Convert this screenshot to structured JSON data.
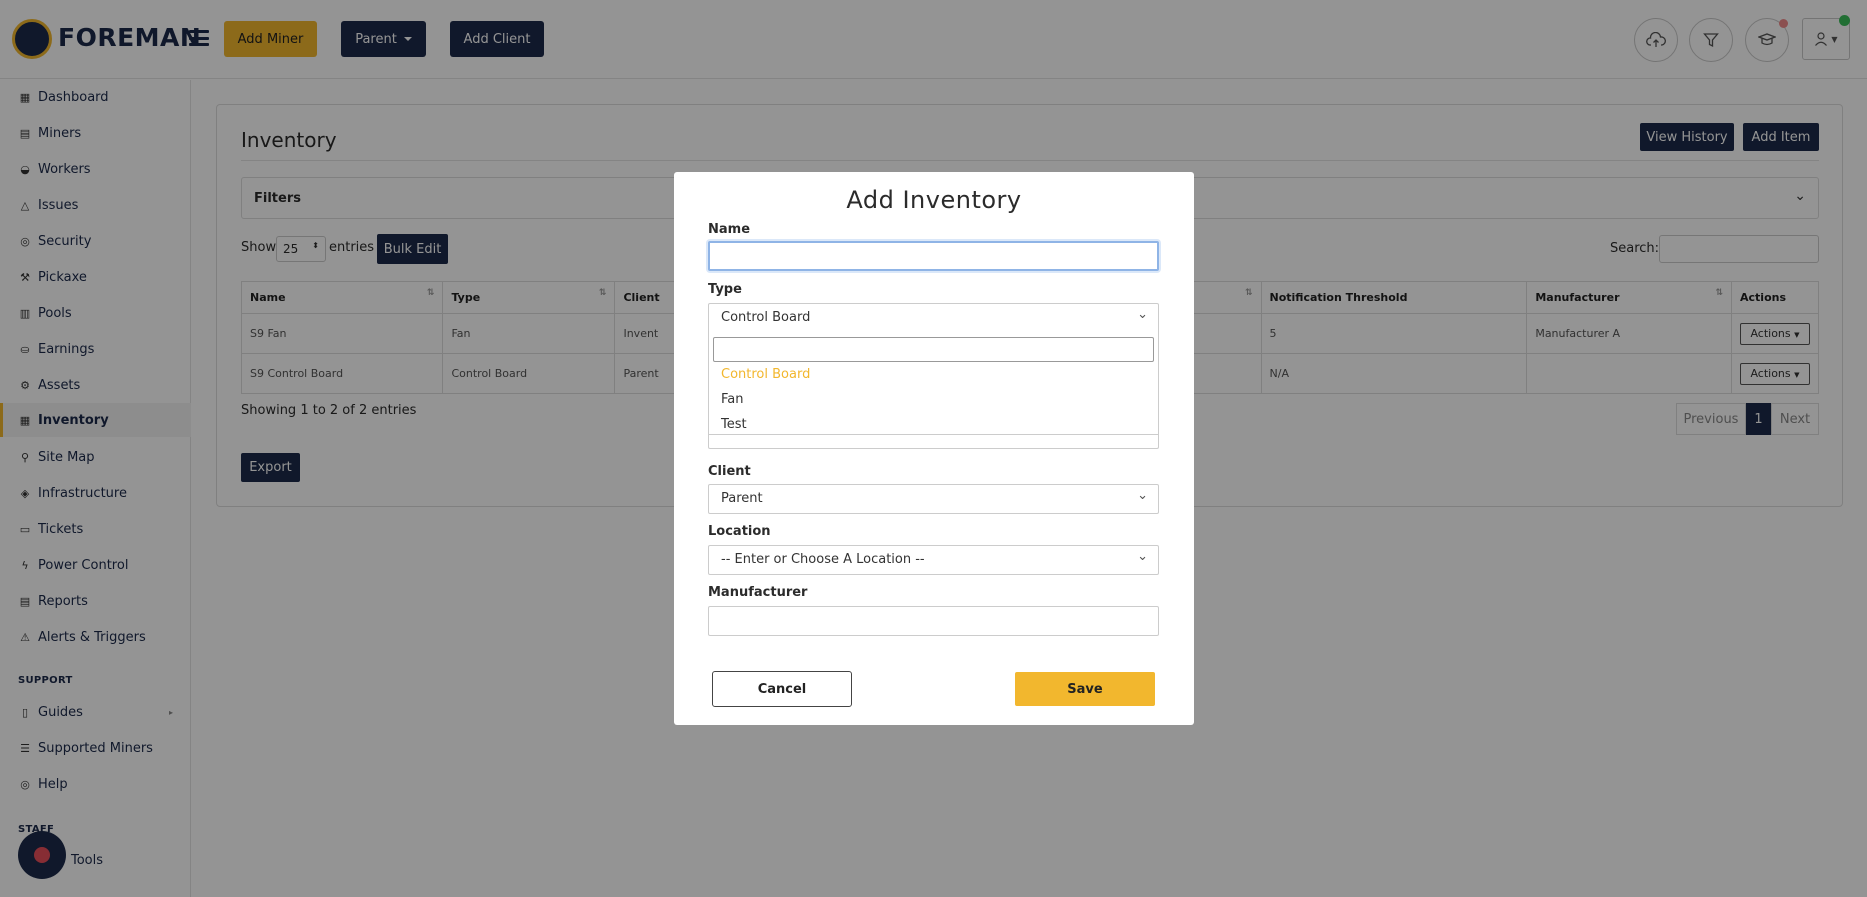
{
  "header": {
    "brand": "FOREMAN",
    "add_miner": "Add Miner",
    "parent": "Parent",
    "add_client": "Add Client",
    "icons": [
      "cloud-upload-icon",
      "filter-icon",
      "graduation-cap-icon",
      "user-icon"
    ]
  },
  "sidebar": {
    "items": [
      {
        "label": "Dashboard",
        "icon": "dashboard-icon"
      },
      {
        "label": "Miners",
        "icon": "server-icon"
      },
      {
        "label": "Workers",
        "icon": "workers-icon"
      },
      {
        "label": "Issues",
        "icon": "warning-icon"
      },
      {
        "label": "Security",
        "icon": "security-icon"
      },
      {
        "label": "Pickaxe",
        "icon": "pickaxe-icon"
      },
      {
        "label": "Pools",
        "icon": "pools-icon"
      },
      {
        "label": "Earnings",
        "icon": "earnings-icon"
      },
      {
        "label": "Assets",
        "icon": "gear-icon"
      },
      {
        "label": "Inventory",
        "icon": "inventory-icon"
      },
      {
        "label": "Site Map",
        "icon": "site-map-icon"
      },
      {
        "label": "Infrastructure",
        "icon": "layers-icon"
      },
      {
        "label": "Tickets",
        "icon": "ticket-icon"
      },
      {
        "label": "Power Control",
        "icon": "lightning-icon"
      },
      {
        "label": "Reports",
        "icon": "reports-icon"
      },
      {
        "label": "Alerts & Triggers",
        "icon": "alert-icon"
      }
    ],
    "support_label": "SUPPORT",
    "support_items": [
      {
        "label": "Guides",
        "icon": "book-icon"
      },
      {
        "label": "Supported Miners",
        "icon": "list-icon"
      },
      {
        "label": "Help",
        "icon": "help-icon"
      }
    ],
    "staff_label": "STAFF",
    "tools_label": "Tools"
  },
  "main": {
    "title": "Inventory",
    "view_history": "View History",
    "add_item": "Add Item",
    "filters": "Filters",
    "show": "Show",
    "page_size": "25",
    "entries": "entries",
    "bulk_edit": "Bulk Edit",
    "search_label": "Search:",
    "columns": [
      "Name",
      "Type",
      "Client",
      "",
      "Notification Threshold",
      "Manufacturer",
      "Actions"
    ],
    "rows": [
      {
        "name": "S9 Fan",
        "type": "Fan",
        "client": "Invent",
        "threshold": "5",
        "manufacturer": "Manufacturer A",
        "actions": "Actions"
      },
      {
        "name": "S9 Control Board",
        "type": "Control Board",
        "client": "Parent",
        "threshold": "N/A",
        "manufacturer": "",
        "actions": "Actions"
      }
    ],
    "showing": "Showing 1 to 2 of 2 entries",
    "previous": "Previous",
    "page": "1",
    "next": "Next",
    "export": "Export"
  },
  "modal": {
    "title": "Add Inventory",
    "name_label": "Name",
    "name_value": "",
    "type_label": "Type",
    "type_value": "Control Board",
    "type_options": [
      "Control Board",
      "Fan",
      "Test"
    ],
    "client_label": "Client",
    "client_value": "Parent",
    "location_label": "Location",
    "location_value": "-- Enter or Choose A Location --",
    "manufacturer_label": "Manufacturer",
    "manufacturer_value": "",
    "cancel": "Cancel",
    "save": "Save"
  },
  "colors": {
    "gold": "#f2b72e",
    "navy": "#1c2a4a"
  }
}
